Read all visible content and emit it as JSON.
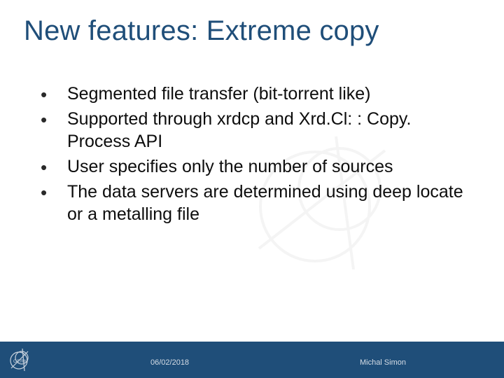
{
  "title": "New features: Extreme copy",
  "bullets": [
    "Segmented file transfer (bit-torrent like)",
    "Supported through xrdcp and Xrd.Cl: : Copy. Process API",
    "User specifies only the number of sources",
    "The data servers are determined using deep locate or a metalling file"
  ],
  "footer": {
    "date": "06/02/2018",
    "author": "Michal Simon"
  }
}
